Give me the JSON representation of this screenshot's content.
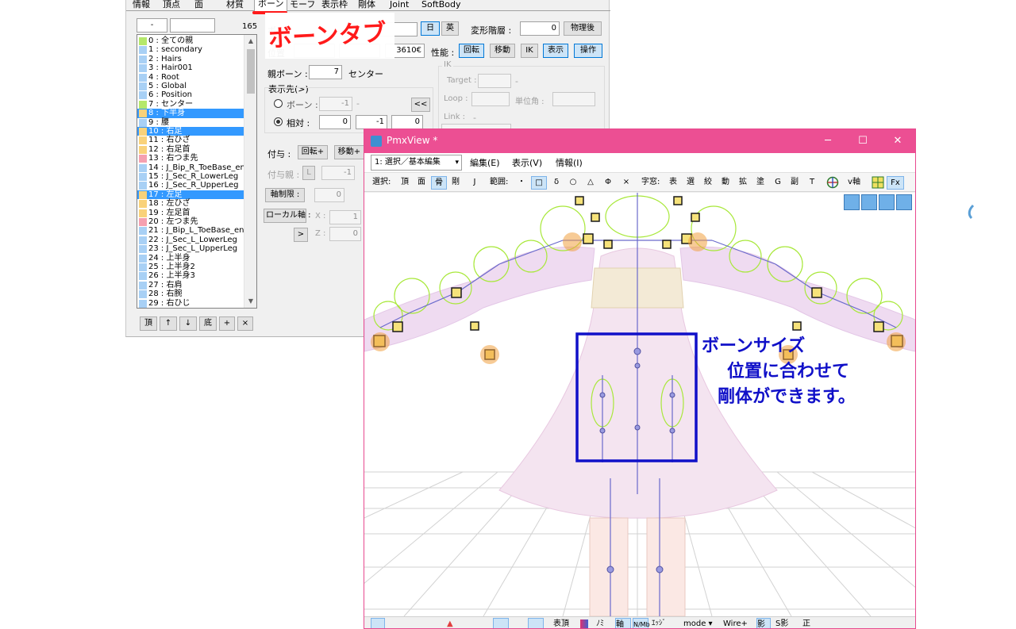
{
  "editor": {
    "tabs": [
      "情報",
      "頂点",
      "面",
      "材質",
      "ボーン",
      "モーフ",
      "表示枠",
      "剛体",
      "Joint",
      "SoftBody"
    ],
    "active_tab": "ボーン",
    "index_field": "-",
    "count": "165",
    "bone_list": [
      {
        "label": "0 : 全ての親",
        "color": "#b5e86b"
      },
      {
        "label": "1 : secondary",
        "color": "#a8d0f5"
      },
      {
        "label": "2 : Hairs",
        "color": "#a8d0f5"
      },
      {
        "label": "3 : Hair001",
        "color": "#a8d0f5"
      },
      {
        "label": "4 : Root",
        "color": "#a8d0f5"
      },
      {
        "label": "5 : Global",
        "color": "#a8d0f5"
      },
      {
        "label": "6 : Position",
        "color": "#a8d0f5"
      },
      {
        "label": "7 : センター",
        "color": "#b5e86b"
      },
      {
        "label": "8 : 下半身",
        "color": "#f9d27a",
        "selected": true
      },
      {
        "label": "9 : 腰",
        "color": "#a8d0f5"
      },
      {
        "label": "10 : 右足",
        "color": "#f9d27a",
        "selected": true
      },
      {
        "label": "11 : 右ひざ",
        "color": "#f9d27a"
      },
      {
        "label": "12 : 右足首",
        "color": "#f9d27a"
      },
      {
        "label": "13 : 右つま先",
        "color": "#f5a0b0"
      },
      {
        "label": "14 : J_Bip_R_ToeBase_en",
        "color": "#a8d0f5"
      },
      {
        "label": "15 : J_Sec_R_LowerLeg",
        "color": "#a8d0f5"
      },
      {
        "label": "16 : J_Sec_R_UpperLeg",
        "color": "#a8d0f5"
      },
      {
        "label": "17 : 左足",
        "color": "#f9d27a",
        "selected": true
      },
      {
        "label": "18 : 左ひざ",
        "color": "#f9d27a"
      },
      {
        "label": "19 : 左足首",
        "color": "#f9d27a"
      },
      {
        "label": "20 : 左つま先",
        "color": "#f5a0b0"
      },
      {
        "label": "21 : J_Bip_L_ToeBase_en",
        "color": "#a8d0f5"
      },
      {
        "label": "22 : J_Sec_L_LowerLeg",
        "color": "#a8d0f5"
      },
      {
        "label": "23 : J_Sec_L_UpperLeg",
        "color": "#a8d0f5"
      },
      {
        "label": "24 : 上半身",
        "color": "#a8d0f5"
      },
      {
        "label": "25 : 上半身2",
        "color": "#a8d0f5"
      },
      {
        "label": "26 : 上半身3",
        "color": "#a8d0f5"
      },
      {
        "label": "27 : 右肩",
        "color": "#a8d0f5"
      },
      {
        "label": "28 : 右腕",
        "color": "#a8d0f5"
      },
      {
        "label": "29 : 右ひじ",
        "color": "#a8d0f5"
      }
    ],
    "list_buttons": [
      "頂",
      "↑",
      "↓",
      "底",
      "+",
      "×"
    ],
    "bone_name_label": "ボー",
    "lang_jp": "日",
    "lang_en": "英",
    "deform_layer_label": "変形階層 :",
    "deform_layer_value": "0",
    "after_physics": "物理後",
    "position_label": "位置",
    "position_value_z": "3610€",
    "performance_label": "性能 :",
    "perf_buttons": [
      "回転",
      "移動",
      "IK",
      "表示",
      "操作"
    ],
    "parent_bone_label": "親ボーン :",
    "parent_bone_value": "7",
    "parent_bone_name": "センター",
    "ik_group": "IK",
    "ik_target_label": "Target :",
    "ik_target_dash": "-",
    "ik_loop_label": "Loop :",
    "ik_unit_angle_label": "単位角 :",
    "ik_link_label": "Link :",
    "ik_link_dash": "-",
    "display_dest_label": "表示先(>)",
    "radio_bone": "ボーン :",
    "radio_bone_value": "-1",
    "radio_bone_dash": "-",
    "radio_relative": "相対 :",
    "relative_values": [
      "0",
      "-1",
      "0"
    ],
    "nav_back": "<<",
    "grant_label": "付与 :",
    "grant_rotate": "回転+",
    "grant_move": "移動+",
    "grant_parent_label": "付与親 :",
    "grant_parent_L": "L",
    "grant_parent_value": "-1",
    "axis_limit": "軸制限 :",
    "axis_limit_value": "0",
    "local_axis": "ローカル軸 :",
    "local_x_label": "X :",
    "local_x_value": "1",
    "local_z_label": "Z :",
    "local_z_value": "0",
    "local_toggle": ">"
  },
  "pmxview": {
    "title": "PmxView *",
    "menu": [
      "編集(E)",
      "表示(V)",
      "情報(I)"
    ],
    "mode_combo": "1: 選択／基本編集",
    "toolbar": {
      "select_label": "選択:",
      "select_items": [
        "頂",
        "面",
        "骨",
        "剛",
        "J"
      ],
      "range_label": "範囲:",
      "range_items": [
        "・",
        "□",
        "δ",
        "○",
        "△",
        "Φ",
        "×"
      ],
      "char_label": "字窓:",
      "char_items": [
        "表",
        "選",
        "絞",
        "動",
        "拡",
        "塗",
        "G",
        "副",
        "T"
      ],
      "v_axis": "v軸",
      "fx": "Fx"
    },
    "bottom": {
      "items": [
        "表頂",
        "ﾉﾐ",
        "軸",
        "N/Mb",
        "ｴｯｼﾞ",
        "mode ▾",
        "Wire+",
        "影",
        "S影",
        "正"
      ]
    }
  },
  "annotations": {
    "tab_note": "ボーンタブ",
    "body_note_lines": [
      "ボーンサイズ",
      "位置に合わせて",
      "剛体ができます。"
    ]
  },
  "colors": {
    "pmxview_title": "#ec4f93",
    "selection": "#3399ff",
    "annotation_red": "#ff1a1a",
    "annotation_blue": "#1010c8"
  }
}
